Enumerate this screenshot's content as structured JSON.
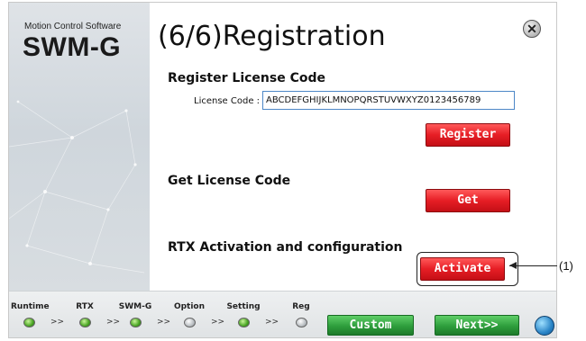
{
  "sidebar": {
    "subtitle": "Motion Control Software",
    "product": "SWM-G"
  },
  "window": {
    "title": "(6/6)Registration",
    "close_icon": "close-icon"
  },
  "register_section": {
    "heading": "Register License Code",
    "license_label": "License Code :",
    "license_value": "ABCDEFGHIJKLMNOPQRSTUVWXYZ0123456789",
    "button_label": "Register"
  },
  "get_section": {
    "heading": "Get License Code",
    "button_label": "Get"
  },
  "rtx_section": {
    "heading": "RTX Activation and configuration",
    "button_label": "Activate"
  },
  "callout": {
    "label": "(1)"
  },
  "steps": [
    {
      "label": "Runtime",
      "state": "on"
    },
    {
      "label": "RTX",
      "state": "on"
    },
    {
      "label": "SWM-G",
      "state": "on"
    },
    {
      "label": "Option",
      "state": "off"
    },
    {
      "label": "Setting",
      "state": "on"
    },
    {
      "label": "Reg",
      "state": "off"
    }
  ],
  "step_separator": ">>",
  "footer": {
    "custom_label": "Custom",
    "next_label": "Next>>",
    "globe_icon": "globe-icon"
  },
  "colors": {
    "accent_red": "#e61e25",
    "accent_green": "#2e9e3c",
    "input_border": "#4d87c7"
  }
}
